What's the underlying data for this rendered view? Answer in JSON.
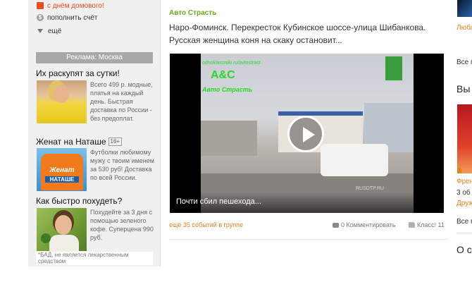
{
  "sidebar": {
    "menu": [
      {
        "label": "с днём домового!",
        "icon": "gift-icon"
      },
      {
        "label": "пополнить счёт",
        "icon": "coin-icon"
      },
      {
        "label": "ещё",
        "icon": "triangle-down-icon"
      }
    ],
    "ads_header": "Реклама: Москва",
    "ads": [
      {
        "title": "Их раскупят за сутки!",
        "image": "dress-model-image",
        "text": "Всего 499 р. модные, платья на каждый день. Быстрая доставка по России - без предоплат."
      },
      {
        "title": "Женат на Наташе",
        "badge": "16+",
        "image": "tshirt-image",
        "image_text_1": "Женат",
        "image_text_2": "НАТАШЕ",
        "text": "Футболки любимому мужу с твоим именем за 530 руб! Доставка по всей России."
      },
      {
        "title": "Как быстро похудеть?",
        "image": "woman-coffee-image",
        "text": "Похудейте за 3 дня с помощью зеленого кофе. Суперцена 990 руб."
      }
    ],
    "disclaimer": "БАД, не является лекарственным средством"
  },
  "post": {
    "group": "Авто Страсть",
    "text": "Наро-Фоминск. Перекресток Кубинское шоссе-улица Шибанкова. Русская женщина коня на скаку остановит...",
    "video": {
      "logo_url": "odnoklassniki.ru/avtostrast",
      "logo": "А&С",
      "logo_sub": "Авто Страсть",
      "watermark": "RUSDTP.RU",
      "caption": "Почти сбил пешехода..."
    },
    "footer": {
      "events": "ещё 35 событий в группе",
      "comments": "0 Комментировать",
      "likes": "Класс! 11"
    }
  },
  "right_column": {
    "texts": [
      "Люба",
      "Все г",
      "Вы",
      "Френ",
      "3 об",
      "Друж",
      "Все г",
      "О с"
    ]
  },
  "colors": {
    "accent_orange": "#e8801b",
    "group_green": "#6aaa1e",
    "alert_red": "#e84e1b"
  }
}
